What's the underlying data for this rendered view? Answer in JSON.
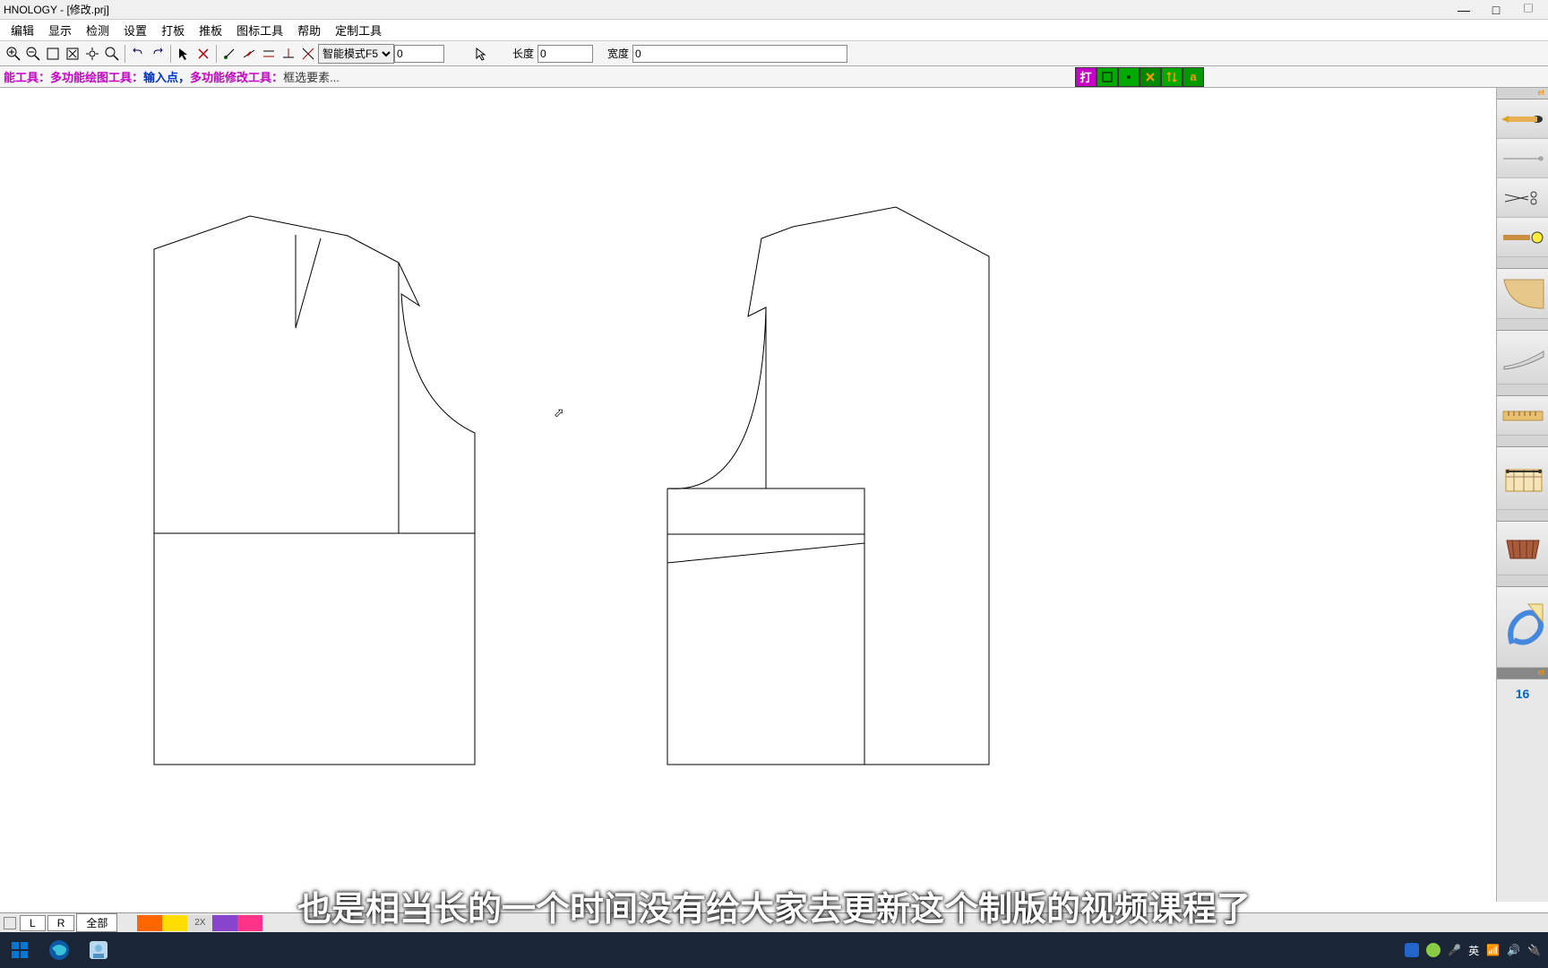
{
  "title": "HNOLOGY - [修改.prj]",
  "menu": [
    "编辑",
    "显示",
    "检测",
    "设置",
    "打板",
    "推板",
    "图标工具",
    "帮助",
    "定制工具"
  ],
  "toolbar": {
    "mode_select": "智能模式F5",
    "mode_value": "0",
    "length_label": "长度",
    "length_value": "0",
    "width_label": "宽度",
    "width_value": "0"
  },
  "hint": {
    "l1": "能工具：",
    "t1": "多功能绘图工具：",
    "l2": "输入点，",
    "t2": "多功能修改工具：",
    "t3": "框选要素..."
  },
  "color_btn_labels": [
    "打",
    "□",
    "◦",
    "✕",
    "↕",
    "a"
  ],
  "bottom": {
    "l": "L",
    "r": "R",
    "all": "全部",
    "size": "2X"
  },
  "right_panel": {
    "tab": "et",
    "number": "16"
  },
  "tray": {
    "ime": "英",
    "icons": [
      "🟢",
      "🟡",
      "🎤",
      "英",
      "📶",
      "🔊",
      "📁"
    ]
  },
  "subtitle": "也是相当长的一个时间没有给大家去更新这个制版的视频课程了"
}
